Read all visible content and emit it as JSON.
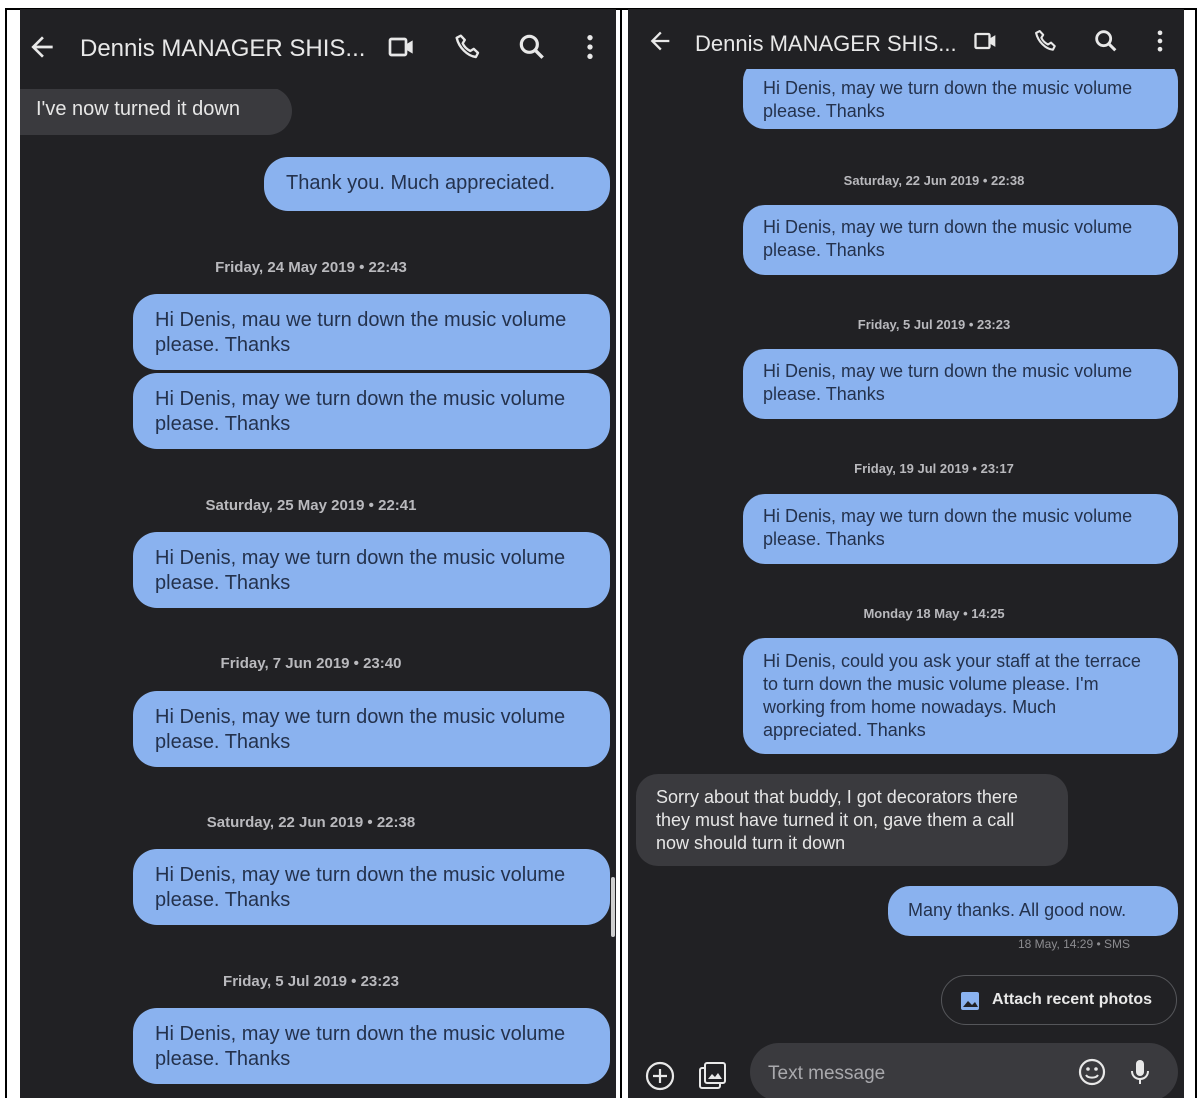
{
  "colors": {
    "panel_background": "#212124",
    "sent_bubble": "#8ab2ef",
    "received_bubble": "#3a3a3e"
  },
  "left_screen": {
    "header": {
      "title": "Dennis MANAGER SHIS...",
      "icons": [
        "back-arrow-icon",
        "video-call-icon",
        "phone-icon",
        "search-icon",
        "more-vert-icon"
      ]
    },
    "messages": [
      {
        "type": "received",
        "text": "I've now turned it down"
      },
      {
        "type": "sent",
        "text": "Thank you. Much appreciated."
      },
      {
        "type": "timestamp",
        "text": "Friday, 24 May 2019 • 22:43"
      },
      {
        "type": "sent",
        "text": "Hi Denis, mau we turn down the music volume please. Thanks"
      },
      {
        "type": "sent",
        "text": "Hi Denis, may we turn down the music volume please. Thanks"
      },
      {
        "type": "timestamp",
        "text": "Saturday, 25 May 2019 • 22:41"
      },
      {
        "type": "sent",
        "text": "Hi Denis, may we turn down the music volume please. Thanks"
      },
      {
        "type": "timestamp",
        "text": "Friday, 7 Jun 2019 • 23:40"
      },
      {
        "type": "sent",
        "text": "Hi Denis, may we turn down the music volume please. Thanks"
      },
      {
        "type": "timestamp",
        "text": "Saturday, 22 Jun 2019 • 22:38"
      },
      {
        "type": "sent",
        "text": "Hi Denis, may we turn down the music volume please. Thanks"
      },
      {
        "type": "timestamp",
        "text": "Friday, 5 Jul 2019 • 23:23"
      },
      {
        "type": "sent",
        "text": "Hi Denis, may we turn down the music volume please. Thanks"
      }
    ]
  },
  "right_screen": {
    "header": {
      "title": "Dennis MANAGER SHIS...",
      "icons": [
        "back-arrow-icon",
        "video-call-icon",
        "phone-icon",
        "search-icon",
        "more-vert-icon"
      ]
    },
    "messages": [
      {
        "type": "sent",
        "text": "Hi Denis, may we turn down the music volume please. Thanks"
      },
      {
        "type": "timestamp",
        "text": "Saturday, 22 Jun 2019 • 22:38"
      },
      {
        "type": "sent",
        "text": "Hi Denis, may we turn down the music volume please. Thanks"
      },
      {
        "type": "timestamp",
        "text": "Friday, 5 Jul 2019 • 23:23"
      },
      {
        "type": "sent",
        "text": "Hi Denis, may we turn down the music volume please. Thanks"
      },
      {
        "type": "timestamp",
        "text": "Friday, 19 Jul 2019 • 23:17"
      },
      {
        "type": "sent",
        "text": "Hi Denis, may we turn down the music volume please. Thanks"
      },
      {
        "type": "timestamp",
        "text": "Monday 18 May • 14:25"
      },
      {
        "type": "sent",
        "text": "Hi Denis, could you ask your staff at the terrace to turn down the music volume please. I'm working from home nowadays. Much appreciated. Thanks"
      },
      {
        "type": "received",
        "text": "Sorry about that buddy, I got decorators there they must have turned it on, gave them a call now should turn it down"
      },
      {
        "type": "sent",
        "text": "Many thanks. All good now."
      },
      {
        "type": "meta",
        "text": "18 May, 14:29 • SMS"
      }
    ],
    "attach_button": {
      "label": "Attach recent photos",
      "icon": "photo-icon"
    },
    "compose": {
      "placeholder": "Text message",
      "icons": [
        "add-icon",
        "gallery-icon",
        "emoji-icon",
        "mic-icon"
      ]
    }
  }
}
